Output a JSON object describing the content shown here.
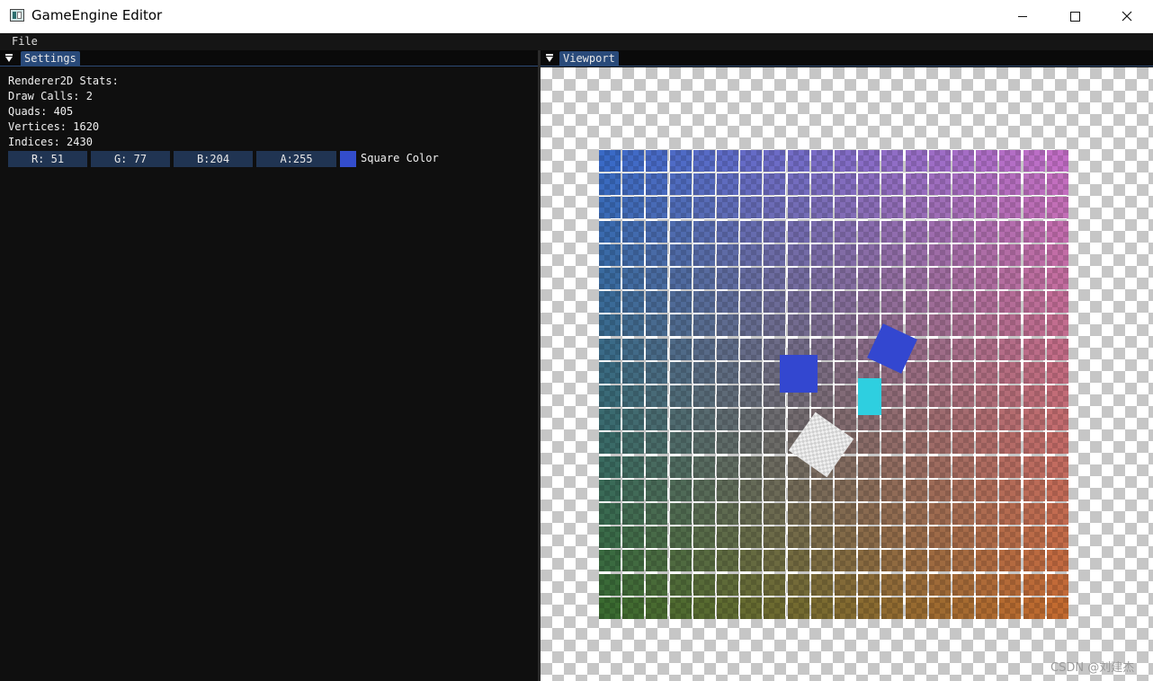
{
  "window": {
    "title": "GameEngine Editor"
  },
  "menu": {
    "file": "File"
  },
  "settings": {
    "tab_label": "Settings",
    "stats": [
      "Renderer2D Stats:",
      "Draw Calls: 2",
      "Quads: 405",
      "Vertices: 1620",
      "Indices: 2430"
    ],
    "color": {
      "r": "R: 51",
      "g": "G: 77",
      "b": "B:204",
      "a": "A:255",
      "swatch_hex": "#334dcc",
      "label": "Square Color"
    }
  },
  "viewport": {
    "tab_label": "Viewport",
    "grid": {
      "rows": 20,
      "cols": 20,
      "color_top_left": "#3a6ac6",
      "color_top_right": "#c26ec6",
      "color_bottom_left": "#3a6a30",
      "color_bottom_right": "#c26a30"
    },
    "squares": [
      {
        "name": "square-quad",
        "color": "#3347d0",
        "rotation_deg": 0
      },
      {
        "name": "rotated-square-quad",
        "color": "#3347d0",
        "rotation_deg": 25
      },
      {
        "name": "cyan-quad",
        "color": "#2ecfe0",
        "rotation_deg": 0
      },
      {
        "name": "checker-quad",
        "color": "#f0f0f0",
        "rotation_deg": 35
      }
    ],
    "watermark": "CSDN @刘建杰"
  }
}
